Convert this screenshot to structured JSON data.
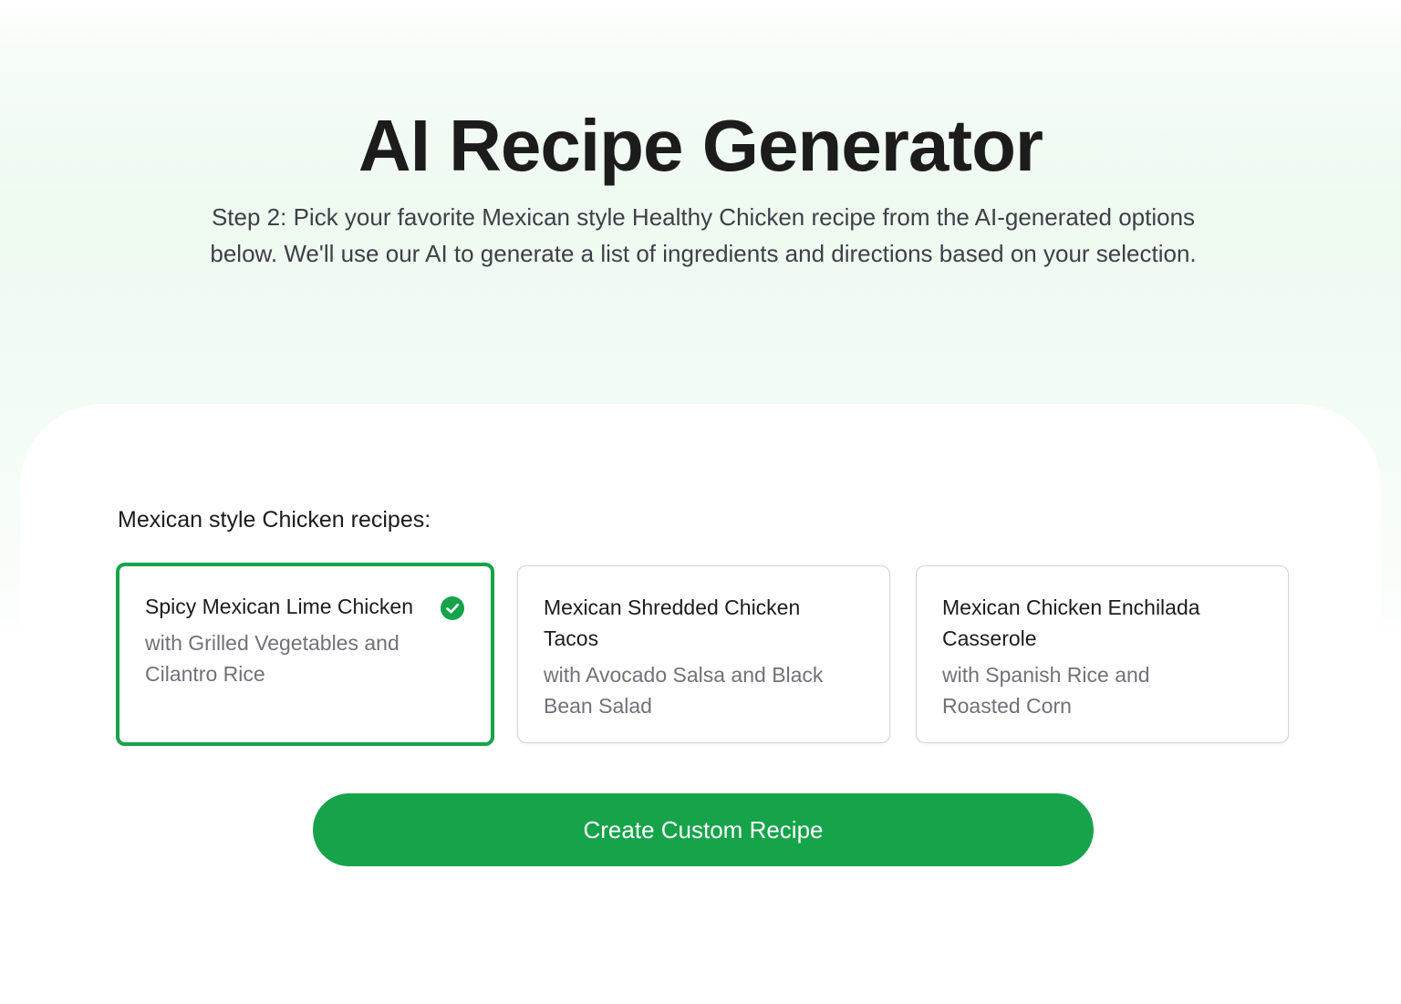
{
  "header": {
    "title": "AI Recipe Generator",
    "subtitle": "Step 2: Pick your favorite Mexican style Healthy Chicken recipe from the AI-generated options below. We'll use our AI to generate a list of ingredients and directions based on your selection."
  },
  "recipes": {
    "label": "Mexican style Chicken recipes:",
    "options": [
      {
        "title": "Spicy Mexican Lime Chicken",
        "subtitle": "with Grilled Vegetables and Cilantro Rice",
        "selected": true,
        "icon": "check-circle-icon"
      },
      {
        "title": "Mexican Shredded Chicken Tacos",
        "subtitle": "with Avocado Salsa and Black Bean Salad",
        "selected": false
      },
      {
        "title": "Mexican Chicken Enchilada Casserole",
        "subtitle": "with Spanish Rice and Roasted Corn",
        "selected": false
      }
    ]
  },
  "actions": {
    "create_label": "Create Custom Recipe"
  },
  "colors": {
    "accent": "#16a34a",
    "text": "#1c1c1c",
    "muted": "#71717a",
    "border": "#d4d4d8"
  }
}
